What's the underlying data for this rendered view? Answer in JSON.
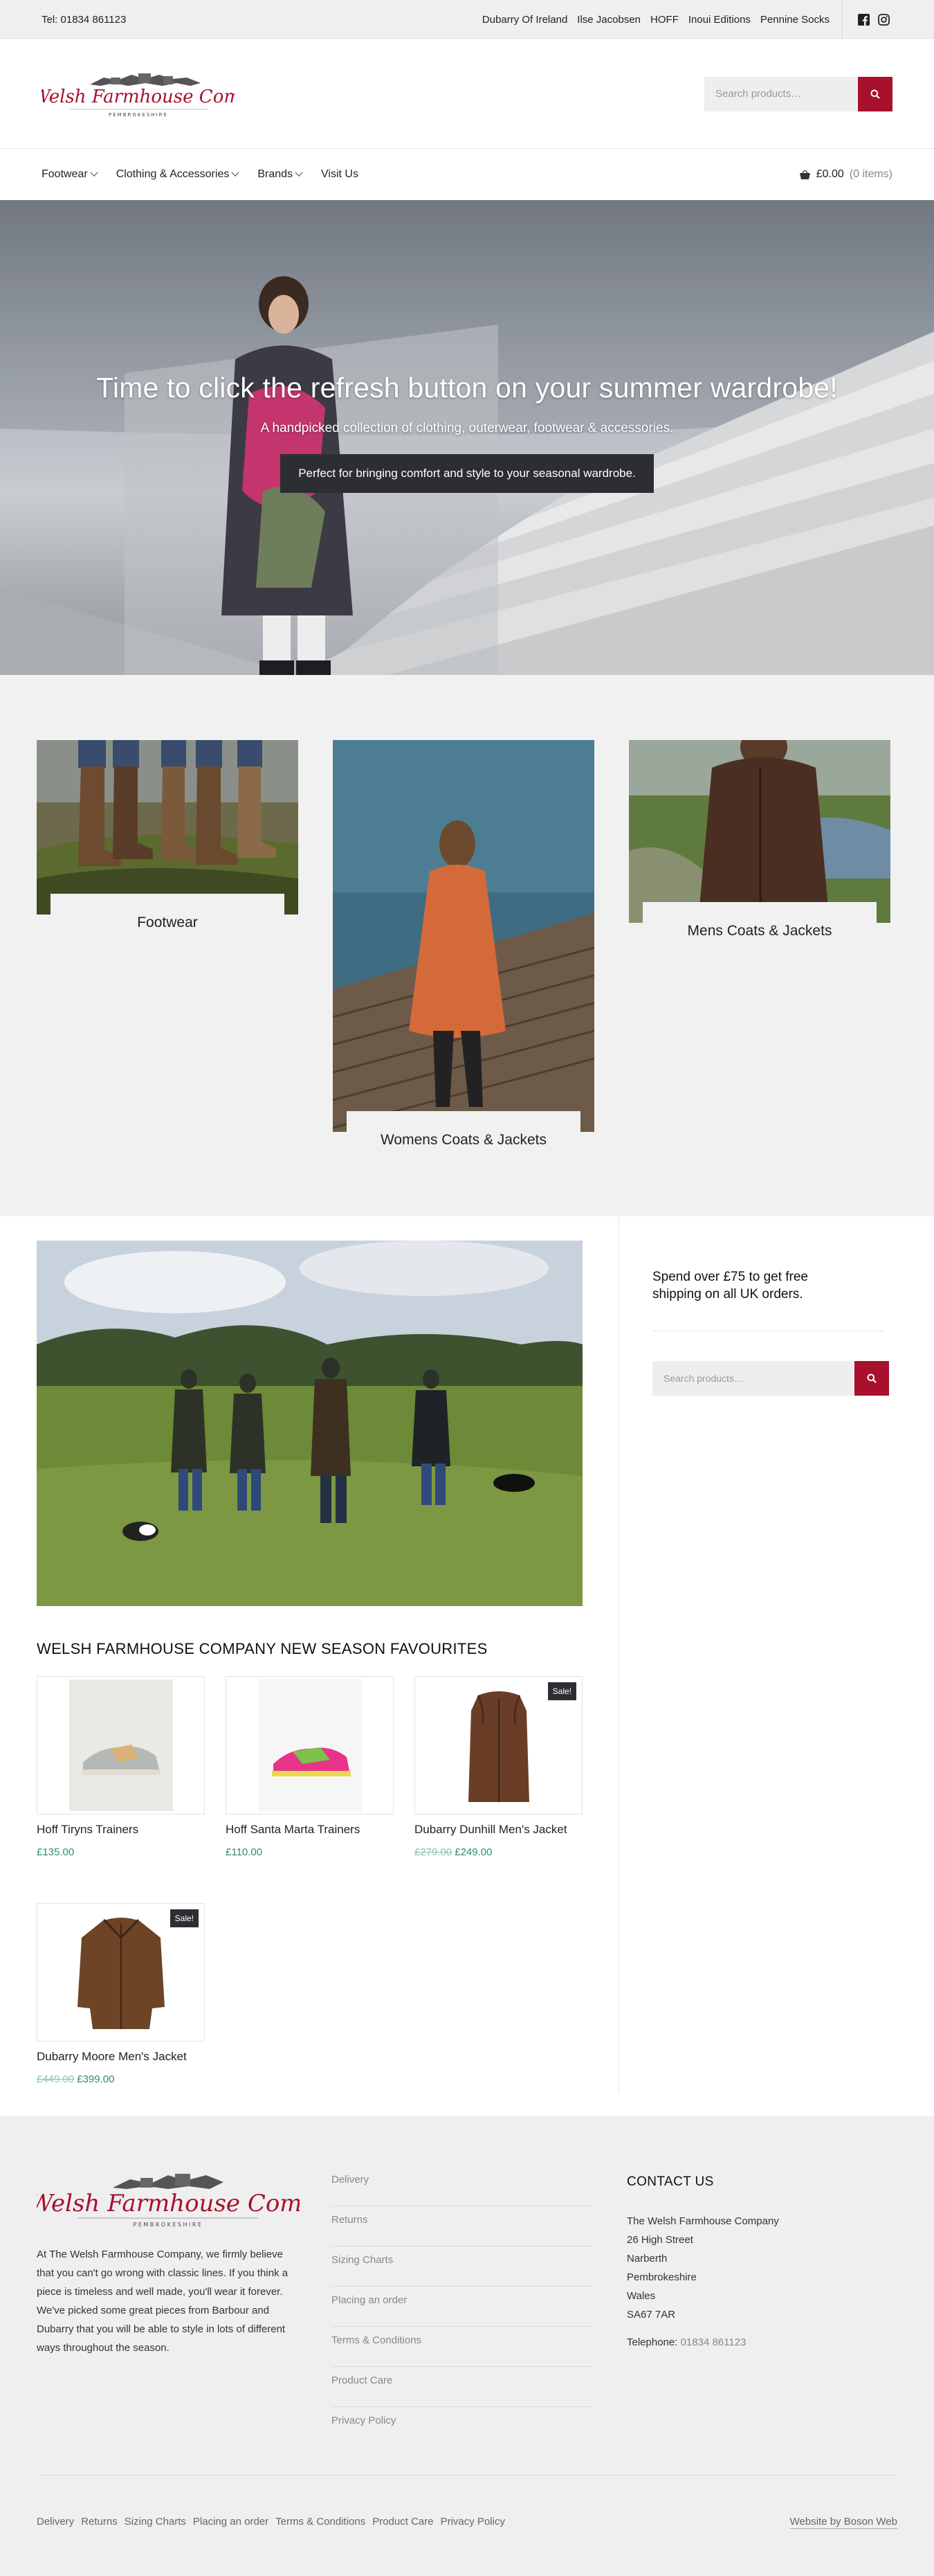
{
  "topbar": {
    "tel": "Tel: 01834 861123",
    "brands": [
      "Dubarry Of Ireland",
      "Ilse Jacobsen",
      "HOFF",
      "Inoui Editions",
      "Pennine Socks"
    ]
  },
  "header": {
    "logo_text": "The Welsh Farmhouse Company",
    "logo_subtext": "PEMBROKESHIRE",
    "search_placeholder": "Search products…"
  },
  "nav": {
    "items": [
      {
        "label": "Footwear",
        "dropdown": true
      },
      {
        "label": "Clothing & Accessories",
        "dropdown": true
      },
      {
        "label": "Brands",
        "dropdown": true
      },
      {
        "label": "Visit Us",
        "dropdown": false
      }
    ],
    "cart_total": "£0.00",
    "cart_items": "(0 items)"
  },
  "hero": {
    "title": "Time to click the refresh button on your summer wardrobe!",
    "subtitle": "A handpicked collection of clothing, outerwear, footwear & accessories.",
    "cta": "Perfect for bringing comfort and style to your seasonal wardrobe."
  },
  "categories": [
    {
      "label": "Footwear"
    },
    {
      "label": "Womens Coats & Jackets"
    },
    {
      "label": "Mens Coats & Jackets"
    }
  ],
  "section_title": "WELSH FARMHOUSE COMPANY NEW SEASON FAVOURITES",
  "products": [
    {
      "name": "Hoff Tiryns Trainers",
      "old_price": "",
      "price": "£135.00",
      "sale": false
    },
    {
      "name": "Hoff Santa Marta Trainers",
      "old_price": "",
      "price": "£110.00",
      "sale": false
    },
    {
      "name": "Dubarry Dunhill Men's Jacket",
      "old_price": "£279.00",
      "price": "£249.00",
      "sale": true
    },
    {
      "name": "Dubarry Moore Men's Jacket",
      "old_price": "£449.00",
      "price": "£399.00",
      "sale": true
    }
  ],
  "sale_label": "Sale!",
  "sidebar": {
    "shipping": "Spend over £75 to get free shipping on all UK orders.",
    "search_placeholder": "Search products…"
  },
  "footer": {
    "about": "At The Welsh Farmhouse Company, we firmly believe that you can't go wrong with classic lines. If you think a piece is timeless and well made, you'll wear it forever. We've picked some great pieces from Barbour and Dubarry that you will be able to style in lots of different ways throughout the season.",
    "links": [
      "Delivery",
      "Returns",
      "Sizing Charts",
      "Placing an order",
      "Terms & Conditions",
      "Product Care",
      "Privacy Policy"
    ],
    "contact_title": "CONTACT US",
    "address": [
      "The Welsh Farmhouse Company",
      "26 High Street",
      "Narberth",
      "Pembrokeshire",
      "Wales",
      "SA67 7AR"
    ],
    "telephone_label": "Telephone:",
    "telephone": "01834 861123",
    "bottom_links": [
      "Delivery",
      "Returns",
      "Sizing Charts",
      "Placing an order",
      "Terms & Conditions",
      "Product Care",
      "Privacy Policy"
    ],
    "credit": "Website by Boson Web"
  },
  "colors": {
    "accent": "#a8102d",
    "price": "#2e8b6a",
    "dark": "#2c2e33"
  }
}
